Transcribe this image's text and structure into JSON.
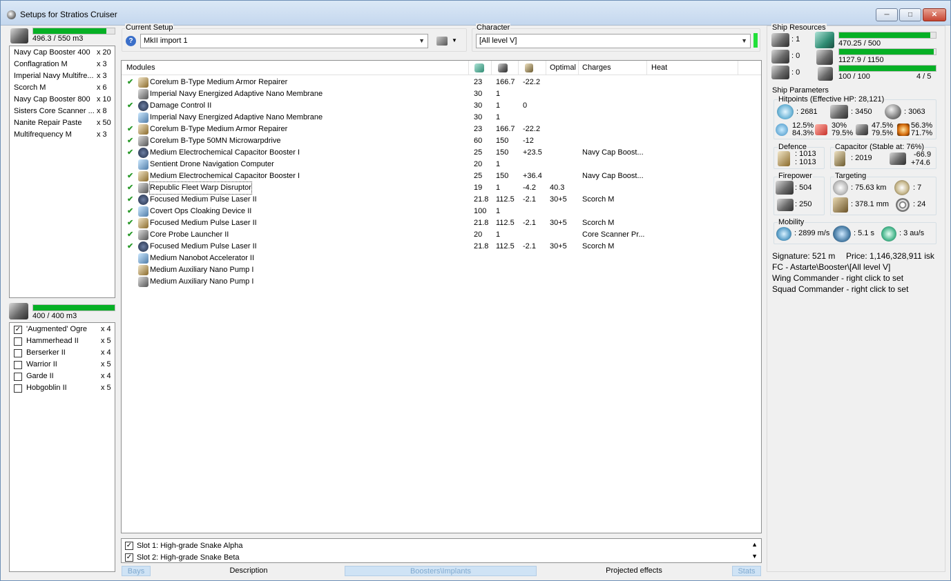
{
  "window": {
    "title": "Setups for Stratios Cruiser"
  },
  "cargo": {
    "capacity": "496.3 / 550 m3",
    "fill": 0.902,
    "items": [
      {
        "name": "Navy Cap Booster 400",
        "qty": "x 20"
      },
      {
        "name": "Conflagration M",
        "qty": "x 3"
      },
      {
        "name": "Imperial Navy Multifre...",
        "qty": "x 3"
      },
      {
        "name": "Scorch M",
        "qty": "x 6"
      },
      {
        "name": "Navy Cap Booster 800",
        "qty": "x 10"
      },
      {
        "name": "Sisters Core Scanner ...",
        "qty": "x 8"
      },
      {
        "name": "Nanite Repair Paste",
        "qty": "x 50"
      },
      {
        "name": "Multifrequency M",
        "qty": "x 3"
      }
    ]
  },
  "drones": {
    "capacity": "400 / 400 m3",
    "fill": 1.0,
    "items": [
      {
        "name": "'Augmented' Ogre",
        "qty": "x 4",
        "checked": true
      },
      {
        "name": "Hammerhead II",
        "qty": "x 5",
        "checked": false
      },
      {
        "name": "Berserker II",
        "qty": "x 4",
        "checked": false
      },
      {
        "name": "Warrior II",
        "qty": "x 5",
        "checked": false
      },
      {
        "name": "Garde II",
        "qty": "x 4",
        "checked": false
      },
      {
        "name": "Hobgoblin II",
        "qty": "x 5",
        "checked": false
      }
    ]
  },
  "setup": {
    "label": "Current Setup",
    "value": "MkII import 1"
  },
  "character": {
    "label": "Character",
    "value": "[All level V]"
  },
  "modules": {
    "headers": {
      "name": "Modules",
      "optimal": "Optimal",
      "charges": "Charges",
      "heat": "Heat"
    },
    "rows": [
      {
        "check": "✔",
        "name": "Corelum B-Type Medium Armor Repairer",
        "c1": "23",
        "c2": "166.7",
        "c3": "-22.2",
        "c4": "",
        "c5": ""
      },
      {
        "check": "",
        "name": "Imperial Navy Energized Adaptive Nano Membrane",
        "c1": "30",
        "c2": "1",
        "c3": "",
        "c4": "",
        "c5": ""
      },
      {
        "check": "✔",
        "name": "Damage Control II",
        "c1": "30",
        "c2": "1",
        "c3": "0",
        "c4": "",
        "c5": ""
      },
      {
        "check": "",
        "name": "Imperial Navy Energized Adaptive Nano Membrane",
        "c1": "30",
        "c2": "1",
        "c3": "",
        "c4": "",
        "c5": ""
      },
      {
        "check": "✔",
        "name": "Corelum B-Type Medium Armor Repairer",
        "c1": "23",
        "c2": "166.7",
        "c3": "-22.2",
        "c4": "",
        "c5": ""
      },
      {
        "check": "✔",
        "name": "Corelum B-Type 50MN Microwarpdrive",
        "c1": "60",
        "c2": "150",
        "c3": "-12",
        "c4": "",
        "c5": ""
      },
      {
        "check": "✔",
        "name": "Medium Electrochemical Capacitor Booster I",
        "c1": "25",
        "c2": "150",
        "c3": "+23.5",
        "c4": "",
        "c5": "Navy Cap Boost..."
      },
      {
        "check": "",
        "name": "Sentient Drone Navigation Computer",
        "c1": "20",
        "c2": "1",
        "c3": "",
        "c4": "",
        "c5": ""
      },
      {
        "check": "✔",
        "name": "Medium Electrochemical Capacitor Booster I",
        "c1": "25",
        "c2": "150",
        "c3": "+36.4",
        "c4": "",
        "c5": "Navy Cap Boost..."
      },
      {
        "check": "✔",
        "name": "Republic Fleet Warp Disruptor",
        "c1": "19",
        "c2": "1",
        "c3": "-4.2",
        "c4": "40.3",
        "c5": ""
      },
      {
        "check": "✔",
        "name": "Focused Medium Pulse Laser II",
        "c1": "21.8",
        "c2": "112.5",
        "c3": "-2.1",
        "c4": "30+5",
        "c5": "Scorch M"
      },
      {
        "check": "✔",
        "name": "Covert Ops Cloaking Device II",
        "c1": "100",
        "c2": "1",
        "c3": "",
        "c4": "",
        "c5": ""
      },
      {
        "check": "✔",
        "name": "Focused Medium Pulse Laser II",
        "c1": "21.8",
        "c2": "112.5",
        "c3": "-2.1",
        "c4": "30+5",
        "c5": "Scorch M"
      },
      {
        "check": "✔",
        "name": "Core Probe Launcher II",
        "c1": "20",
        "c2": "1",
        "c3": "",
        "c4": "",
        "c5": "Core Scanner Pr..."
      },
      {
        "check": "✔",
        "name": "Focused Medium Pulse Laser II",
        "c1": "21.8",
        "c2": "112.5",
        "c3": "-2.1",
        "c4": "30+5",
        "c5": "Scorch M"
      },
      {
        "check": "",
        "name": "Medium Nanobot Accelerator II",
        "c1": "",
        "c2": "",
        "c3": "",
        "c4": "",
        "c5": ""
      },
      {
        "check": "",
        "name": "Medium Auxiliary Nano Pump I",
        "c1": "",
        "c2": "",
        "c3": "",
        "c4": "",
        "c5": ""
      },
      {
        "check": "",
        "name": "Medium Auxiliary Nano Pump I",
        "c1": "",
        "c2": "",
        "c3": "",
        "c4": "",
        "c5": ""
      }
    ]
  },
  "implants": [
    {
      "label": "Slot 1: High-grade Snake Alpha",
      "checked": true
    },
    {
      "label": "Slot 2: High-grade Snake Beta",
      "checked": true
    }
  ],
  "tabs": [
    "Bays",
    "Description",
    "Boosters\\Implants",
    "Projected effects",
    "Stats"
  ],
  "resources": {
    "label": "Ship Resources",
    "turret": ": 1",
    "launcher": ": 0",
    "drone": ": 0",
    "cpu": "470.25 / 500",
    "cpu_fill": 0.9405,
    "power": "1127.9 / 1150",
    "power_fill": 0.981,
    "bandwidth": "100 / 100",
    "bandwidth_fill": 1.0,
    "drones_active": "4 / 5"
  },
  "params": {
    "label": "Ship Parameters",
    "hitpoints_label": "Hitpoints (Effective HP: 28,121)",
    "shield_hp": ": 2681",
    "armor_hp": ": 3450",
    "structure_hp": ": 3063",
    "res_em": [
      "12.5%",
      "84.3%"
    ],
    "res_thermal": [
      "30%",
      "79.5%"
    ],
    "res_kinetic": [
      "47.5%",
      "79.5%"
    ],
    "res_explosive": [
      "56.3%",
      "71.7%"
    ],
    "defence_label": "Defence",
    "defence": [
      ": 1013",
      ": 1013"
    ],
    "capacitor_label": "Capacitor (Stable at: 76%)",
    "capacitor": ": 2019",
    "capacitor_delta": [
      "-66.9",
      "+74.6"
    ],
    "firepower_label": "Firepower",
    "firepower": ": 504",
    "drone_dps": ": 250",
    "targeting_label": "Targeting",
    "target_range": ": 75.63 km",
    "max_targets": ": 7",
    "scan_res": ": 378.1 mm",
    "sensor_strength": ": 24",
    "mobility_label": "Mobility",
    "velocity": ": 2899 m/s",
    "align": ": 5.1 s",
    "warp": ": 3 au/s",
    "signature": "Signature: 521 m",
    "price": "Price: 1,146,328,911 isk",
    "fc": "FC - Astarte\\Booster\\[All level V]",
    "wing": "Wing Commander - right click to set",
    "squad": "Squad Commander - right click to set"
  },
  "colors": {
    "bar_fill": "#06b025",
    "check": "#2a9a2a",
    "tab_dim": "#cfe3f5"
  }
}
